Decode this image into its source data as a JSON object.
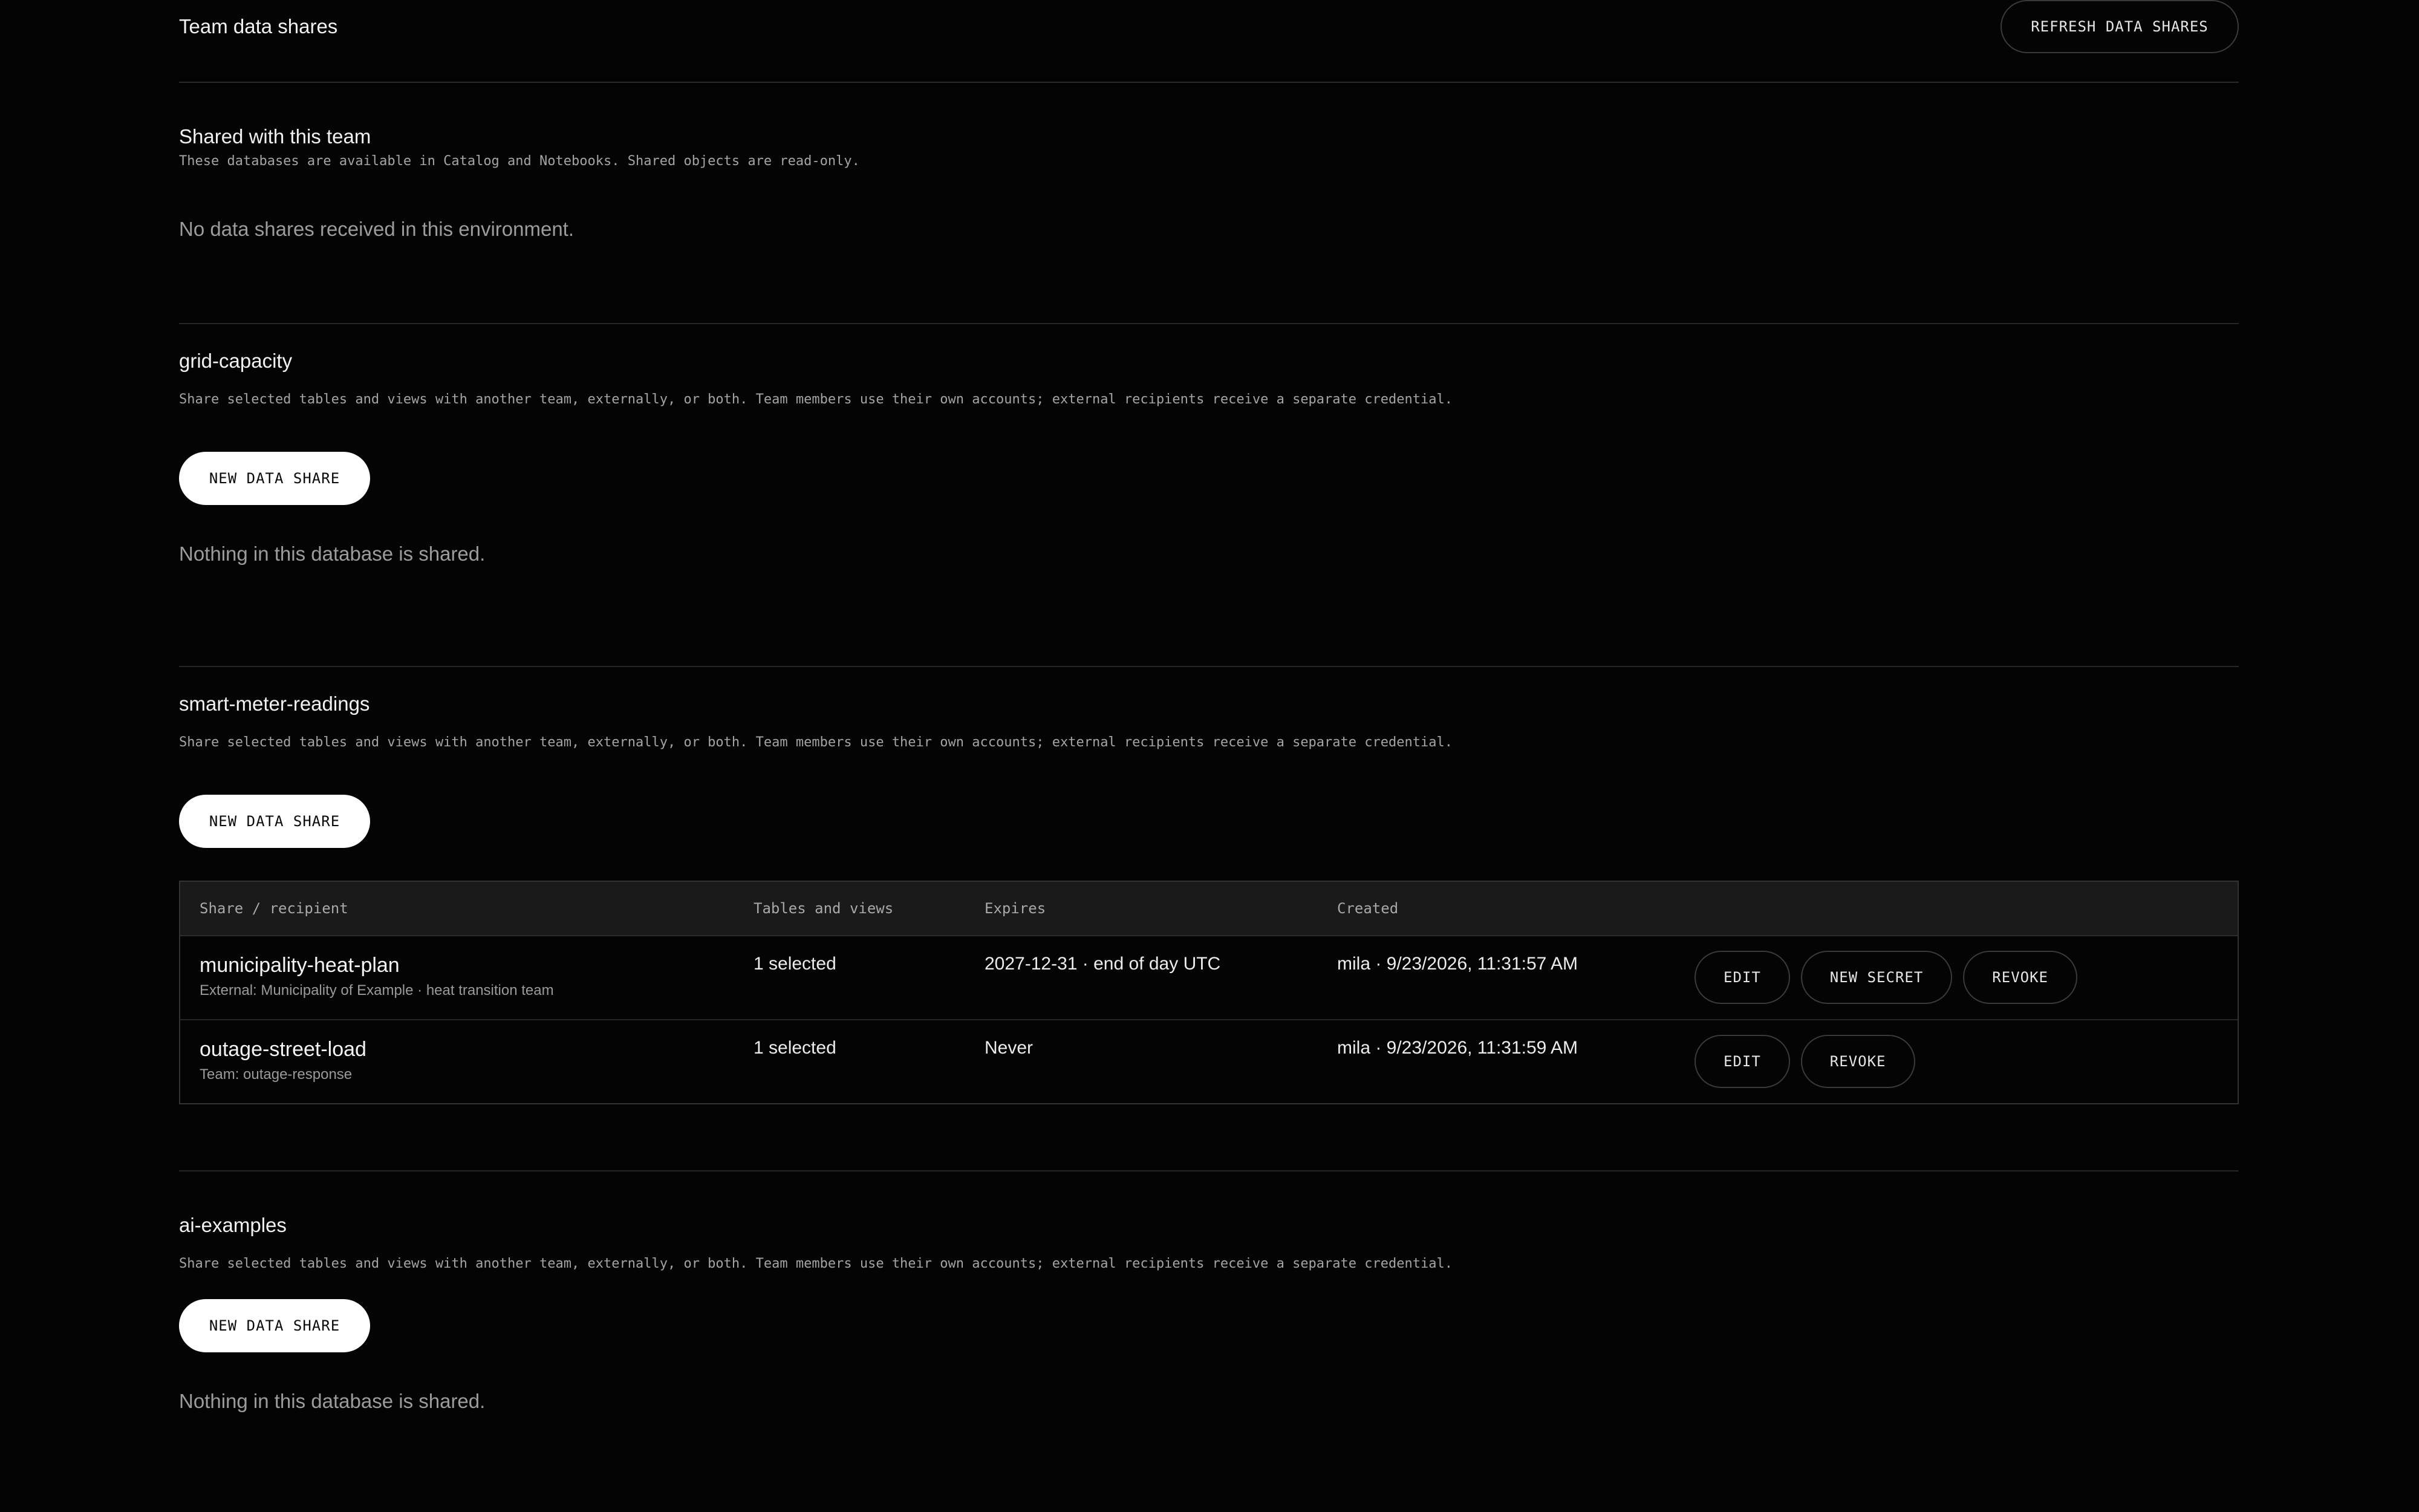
{
  "header": {
    "title": "Team data shares",
    "refresh_label": "REFRESH DATA SHARES"
  },
  "shared_with_team": {
    "title": "Shared with this team",
    "description": "These databases are available in Catalog and Notebooks. Shared objects are read-only.",
    "empty_text": "No data shares received in this environment."
  },
  "databases": [
    {
      "name": "grid-capacity",
      "description": "Share selected tables and views with another team, externally, or both. Team members use their own accounts; external recipients receive a separate credential.",
      "new_share_label": "NEW DATA SHARE",
      "empty_text": "Nothing in this database is shared."
    },
    {
      "name": "smart-meter-readings",
      "description": "Share selected tables and views with another team, externally, or both. Team members use their own accounts; external recipients receive a separate credential.",
      "new_share_label": "NEW DATA SHARE",
      "table": {
        "columns": [
          "Share / recipient",
          "Tables and views",
          "Expires",
          "Created"
        ],
        "rows": [
          {
            "name": "municipality-heat-plan",
            "recipient": "External: Municipality of Example · heat transition team",
            "tables": "1 selected",
            "expires": "2027-12-31 · end of day UTC",
            "created": "mila · 9/23/2026, 11:31:57 AM",
            "actions": [
              "EDIT",
              "NEW SECRET",
              "REVOKE"
            ]
          },
          {
            "name": "outage-street-load",
            "recipient": "Team: outage-response",
            "tables": "1 selected",
            "expires": "Never",
            "created": "mila · 9/23/2026, 11:31:59 AM",
            "actions": [
              "EDIT",
              "REVOKE"
            ]
          }
        ]
      }
    },
    {
      "name": "ai-examples",
      "description": "Share selected tables and views with another team, externally, or both. Team members use their own accounts; external recipients receive a separate credential.",
      "new_share_label": "NEW DATA SHARE",
      "empty_text": "Nothing in this database is shared."
    }
  ]
}
